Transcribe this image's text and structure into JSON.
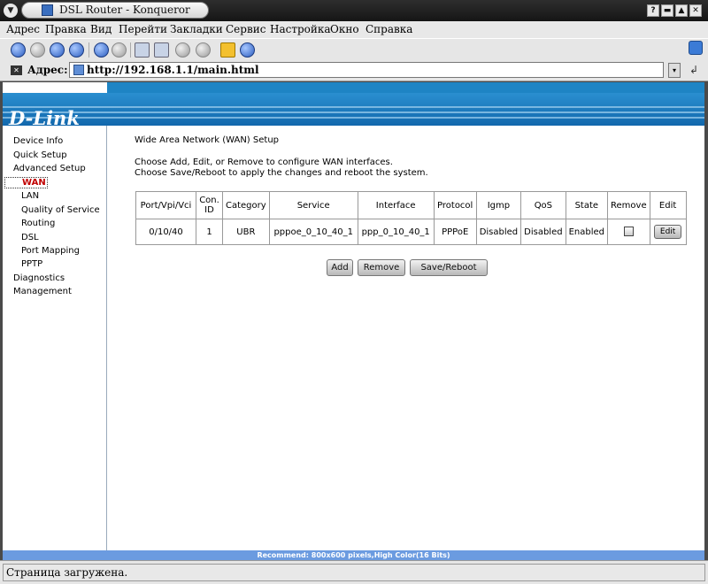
{
  "window": {
    "title": "DSL Router - Konqueror",
    "menu_button": "▼",
    "buttons": {
      "help": "?",
      "minimize": "▬",
      "maximize": "▲",
      "close": "✕"
    }
  },
  "menubar": [
    "Адрес",
    "Правка",
    "Вид",
    "Перейти",
    "Закладки",
    "Сервис",
    "Настройка",
    "Окно",
    "Справка"
  ],
  "toolbar": {
    "icons": [
      "back-icon",
      "forward-icon",
      "up-icon",
      "home-icon",
      "reload-icon",
      "stop-icon",
      "print-icon",
      "print-frame-icon",
      "zoom-in-icon",
      "zoom-out-icon",
      "security-lock-icon",
      "download-icon"
    ]
  },
  "addressbar": {
    "label": "Адрес:",
    "url": "http://192.168.1.1/main.html",
    "dropdown": "▾",
    "go": "↲"
  },
  "page": {
    "logo": "D-Link",
    "nav": [
      {
        "label": "Device Info",
        "level": 0
      },
      {
        "label": "Quick Setup",
        "level": 0
      },
      {
        "label": "Advanced Setup",
        "level": 0
      },
      {
        "label": "WAN",
        "level": 1,
        "selected": true
      },
      {
        "label": "LAN",
        "level": 1
      },
      {
        "label": "Quality of Service",
        "level": 1
      },
      {
        "label": "Routing",
        "level": 1
      },
      {
        "label": "DSL",
        "level": 1
      },
      {
        "label": "Port Mapping",
        "level": 1
      },
      {
        "label": "PPTP",
        "level": 1
      },
      {
        "label": "Diagnostics",
        "level": 0
      },
      {
        "label": "Management",
        "level": 0
      }
    ],
    "heading": "Wide Area Network (WAN) Setup",
    "instructions": [
      "Choose Add, Edit, or Remove to configure WAN interfaces.",
      "Choose Save/Reboot to apply the changes and reboot the system."
    ],
    "table": {
      "headers": [
        "Port/Vpi/Vci",
        "Con. ID",
        "Category",
        "Service",
        "Interface",
        "Protocol",
        "Igmp",
        "QoS",
        "State",
        "Remove",
        "Edit"
      ],
      "rows": [
        [
          "0/10/40",
          "1",
          "UBR",
          "pppoe_0_10_40_1",
          "ppp_0_10_40_1",
          "PPPoE",
          "Disabled",
          "Disabled",
          "Enabled",
          "",
          "Edit"
        ]
      ]
    },
    "buttons": {
      "add": "Add",
      "remove": "Remove",
      "save_reboot": "Save/Reboot"
    },
    "recommend": "Recommend: 800x600 pixels,High Color(16 Bits)"
  },
  "statusbar": {
    "text": "Страница загружена."
  },
  "colors": {
    "banner": "#1e84c4",
    "recommend_bar": "#6b9be0",
    "selected_nav": "#c00000"
  }
}
